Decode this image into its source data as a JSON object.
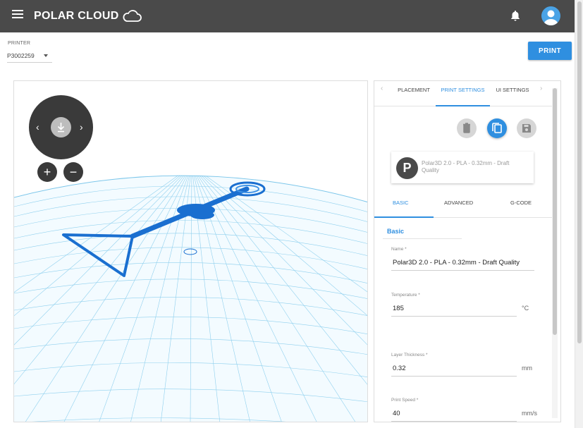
{
  "topbar": {
    "logo_text": "POLAR CLOUD",
    "icons": [
      "menu-icon",
      "cloud-icon",
      "bell-icon",
      "user-icon"
    ],
    "bg_color": "#4a4a4a"
  },
  "printer": {
    "label": "PRINTER",
    "selected": "P3002259"
  },
  "print_button": "PRINT",
  "accent_color": "#2f8fe0",
  "viewport": {
    "nav_icons": [
      "chevron-left-icon",
      "home-icon",
      "chevron-right-icon"
    ],
    "zoom_in": "+",
    "zoom_out": "−"
  },
  "panel": {
    "tabs": [
      "PLACEMENT",
      "PRINT SETTINGS",
      "UI SETTINGS"
    ],
    "active_tab": "PRINT SETTINGS",
    "actions": [
      "delete-icon",
      "copy-icon",
      "save-icon"
    ],
    "profile": {
      "logo": "P",
      "name": "Polar3D 2.0 - PLA - 0.32mm - Draft Quality"
    },
    "subtabs": [
      "BASIC",
      "ADVANCED",
      "G-CODE"
    ],
    "active_subtab": "BASIC",
    "section_title": "Basic",
    "fields": {
      "name": {
        "label": "Name *",
        "value": "Polar3D 2.0 - PLA - 0.32mm - Draft Quality"
      },
      "temperature": {
        "label": "Temperature *",
        "value": "185",
        "unit": "°C"
      },
      "layer_thickness": {
        "label": "Layer Thickness *",
        "value": "0.32",
        "unit": "mm"
      },
      "print_speed": {
        "label": "Print Speed *",
        "value": "40",
        "unit": "mm/s"
      }
    }
  }
}
